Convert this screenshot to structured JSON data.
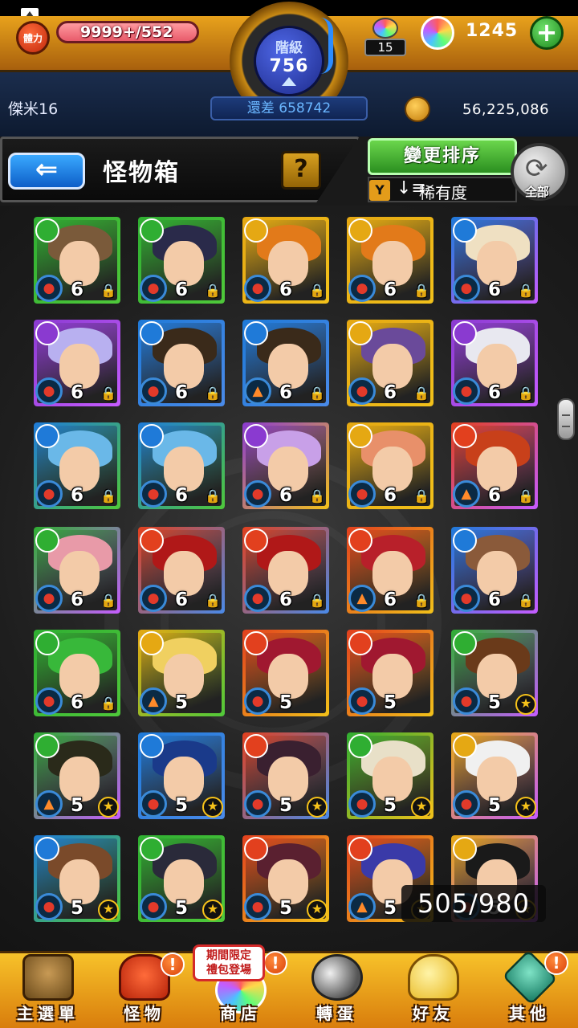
{
  "header": {
    "stamina_label": "體力",
    "stamina_current": "9999+",
    "stamina_max": "/552",
    "rank_label": "階級",
    "rank_value": "756",
    "exp_remaining": "還差 658742",
    "gacha_orb_count": "15",
    "orb_value": "1245",
    "add_orb": "+",
    "player_name": "傑米16",
    "gold_value": "56,225,086"
  },
  "toolbar": {
    "back_arrow": "⇐",
    "page_title": "怪物箱",
    "help_label": "?",
    "sort_button": "變更排序",
    "filter_icon": "Y",
    "sort_icon": "↓≡",
    "sort_mode": "稀有度",
    "all_icon": "⟳",
    "all_label": "全部"
  },
  "box_count": "505/980",
  "colors": {
    "fire": "#e2401e",
    "water": "#1f7ad8",
    "wood": "#2fae32",
    "light": "#e5a813",
    "dark": "#8a3ad0",
    "frame_gold": "#f2c11a",
    "frame_green": "#4fc93a",
    "frame_rainbow": "#c65cff"
  },
  "monsters": [
    {
      "element": "wood",
      "rarity": "6",
      "badge": "lock",
      "type_icon": "●"
    },
    {
      "element": "wood",
      "rarity": "6",
      "badge": "lock",
      "type_icon": "●"
    },
    {
      "element": "light",
      "rarity": "6",
      "badge": "lock",
      "type_icon": "●"
    },
    {
      "element": "light",
      "rarity": "6",
      "badge": "lock",
      "type_icon": "●"
    },
    {
      "element": "water",
      "rarity": "6",
      "badge": "lock",
      "type_icon": "●"
    },
    {
      "element": "dark",
      "rarity": "6",
      "badge": "lock",
      "type_icon": "●"
    },
    {
      "element": "water",
      "rarity": "6",
      "badge": "lock",
      "type_icon": "●"
    },
    {
      "element": "water",
      "rarity": "6",
      "badge": "lock",
      "type_icon": "▲"
    },
    {
      "element": "light",
      "rarity": "6",
      "badge": "lock",
      "type_icon": "●"
    },
    {
      "element": "dark",
      "rarity": "6",
      "badge": "lock",
      "type_icon": "●"
    },
    {
      "element": "water",
      "rarity": "6",
      "badge": "lock",
      "type_icon": "●"
    },
    {
      "element": "water",
      "rarity": "6",
      "badge": "lock",
      "type_icon": "●"
    },
    {
      "element": "dark",
      "rarity": "6",
      "badge": "lock",
      "type_icon": "●"
    },
    {
      "element": "light",
      "rarity": "6",
      "badge": "lock",
      "type_icon": "●"
    },
    {
      "element": "fire",
      "rarity": "6",
      "badge": "lock",
      "type_icon": "▲"
    },
    {
      "element": "wood",
      "rarity": "6",
      "badge": "lock",
      "type_icon": "●"
    },
    {
      "element": "fire",
      "rarity": "6",
      "badge": "lock",
      "type_icon": "●"
    },
    {
      "element": "fire",
      "rarity": "6",
      "badge": "lock",
      "type_icon": "●"
    },
    {
      "element": "fire",
      "rarity": "6",
      "badge": "lock",
      "type_icon": "▲"
    },
    {
      "element": "water",
      "rarity": "6",
      "badge": "lock",
      "type_icon": "●"
    },
    {
      "element": "wood",
      "rarity": "6",
      "badge": "lock",
      "type_icon": "●"
    },
    {
      "element": "light",
      "rarity": "5",
      "badge": "none",
      "type_icon": "▲"
    },
    {
      "element": "fire",
      "rarity": "5",
      "badge": "none",
      "type_icon": "●"
    },
    {
      "element": "fire",
      "rarity": "5",
      "badge": "none",
      "type_icon": "●"
    },
    {
      "element": "wood",
      "rarity": "5",
      "badge": "star",
      "type_icon": "●"
    },
    {
      "element": "wood",
      "rarity": "5",
      "badge": "star",
      "type_icon": "▲"
    },
    {
      "element": "water",
      "rarity": "5",
      "badge": "star",
      "type_icon": "●"
    },
    {
      "element": "fire",
      "rarity": "5",
      "badge": "star",
      "type_icon": "●"
    },
    {
      "element": "wood",
      "rarity": "5",
      "badge": "star",
      "type_icon": "●"
    },
    {
      "element": "light",
      "rarity": "5",
      "badge": "star",
      "type_icon": "●"
    },
    {
      "element": "water",
      "rarity": "5",
      "badge": "star",
      "type_icon": "●"
    },
    {
      "element": "wood",
      "rarity": "5",
      "badge": "star",
      "type_icon": "●"
    },
    {
      "element": "fire",
      "rarity": "5",
      "badge": "star",
      "type_icon": "●"
    },
    {
      "element": "fire",
      "rarity": "5",
      "badge": "star",
      "type_icon": "▲"
    },
    {
      "element": "light",
      "rarity": "5",
      "badge": "star",
      "type_icon": "●"
    }
  ],
  "nav": {
    "main_menu": "主選單",
    "monster": "怪物",
    "shop": "商店",
    "gacha": "轉蛋",
    "friends": "好友",
    "other": "其他",
    "alert_mark": "!",
    "shop_promo": "期間限定\n禮包登場"
  }
}
